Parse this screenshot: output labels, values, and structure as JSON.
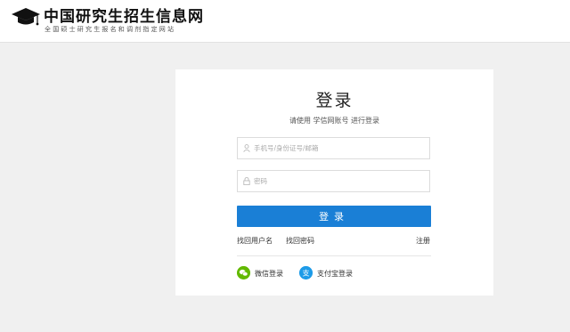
{
  "header": {
    "site_title": "中国研究生招生信息网",
    "site_subtitle": "全国硕士研究生报名和调剂指定网站",
    "logo_icon": "graduation-cap-icon"
  },
  "login": {
    "title": "登录",
    "subtitle": "请使用 学信网账号 进行登录",
    "username": {
      "value": "",
      "placeholder": "手机号/身份证号/邮箱",
      "icon": "user-icon"
    },
    "password": {
      "value": "",
      "placeholder": "密码",
      "icon": "lock-icon"
    },
    "submit_label": "登录",
    "links": {
      "find_username": "找回用户名",
      "find_password": "找回密码",
      "register": "注册"
    },
    "social": {
      "wechat_label": "微信登录",
      "alipay_label": "支付宝登录",
      "alipay_glyph": "支"
    }
  },
  "colors": {
    "accent": "#1a7fd6",
    "wechat": "#62b900",
    "alipay": "#1d9be8",
    "background": "#f0f0f0"
  }
}
